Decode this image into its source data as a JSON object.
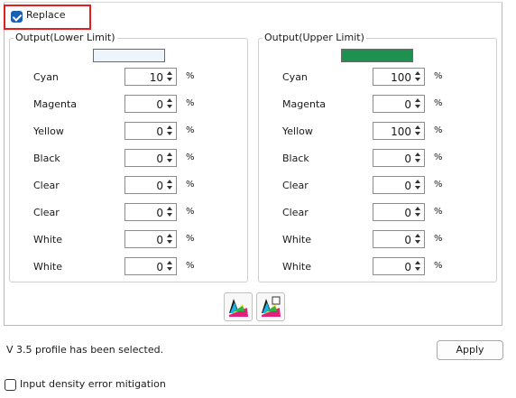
{
  "replace": {
    "label": "Replace",
    "checked": true
  },
  "lower": {
    "title": "Output(Lower Limit)",
    "swatch_color": "#eef4fb",
    "rows": [
      {
        "label": "Cyan",
        "value": "10"
      },
      {
        "label": "Magenta",
        "value": "0"
      },
      {
        "label": "Yellow",
        "value": "0"
      },
      {
        "label": "Black",
        "value": "0"
      },
      {
        "label": "Clear",
        "value": "0"
      },
      {
        "label": "Clear",
        "value": "0"
      },
      {
        "label": "White",
        "value": "0"
      },
      {
        "label": "White",
        "value": "0"
      }
    ]
  },
  "upper": {
    "title": "Output(Upper Limit)",
    "swatch_color": "#1e9150",
    "rows": [
      {
        "label": "Cyan",
        "value": "100"
      },
      {
        "label": "Magenta",
        "value": "0"
      },
      {
        "label": "Yellow",
        "value": "100"
      },
      {
        "label": "Black",
        "value": "0"
      },
      {
        "label": "Clear",
        "value": "0"
      },
      {
        "label": "Clear",
        "value": "0"
      },
      {
        "label": "White",
        "value": "0"
      },
      {
        "label": "White",
        "value": "0"
      }
    ]
  },
  "percent_symbol": "%",
  "icons": [
    "color-palette-icon",
    "color-palette-pick-icon"
  ],
  "status_text": "V 3.5 profile has been selected.",
  "apply_label": "Apply",
  "mitigation": {
    "label": "Input density error mitigation",
    "checked": false
  }
}
